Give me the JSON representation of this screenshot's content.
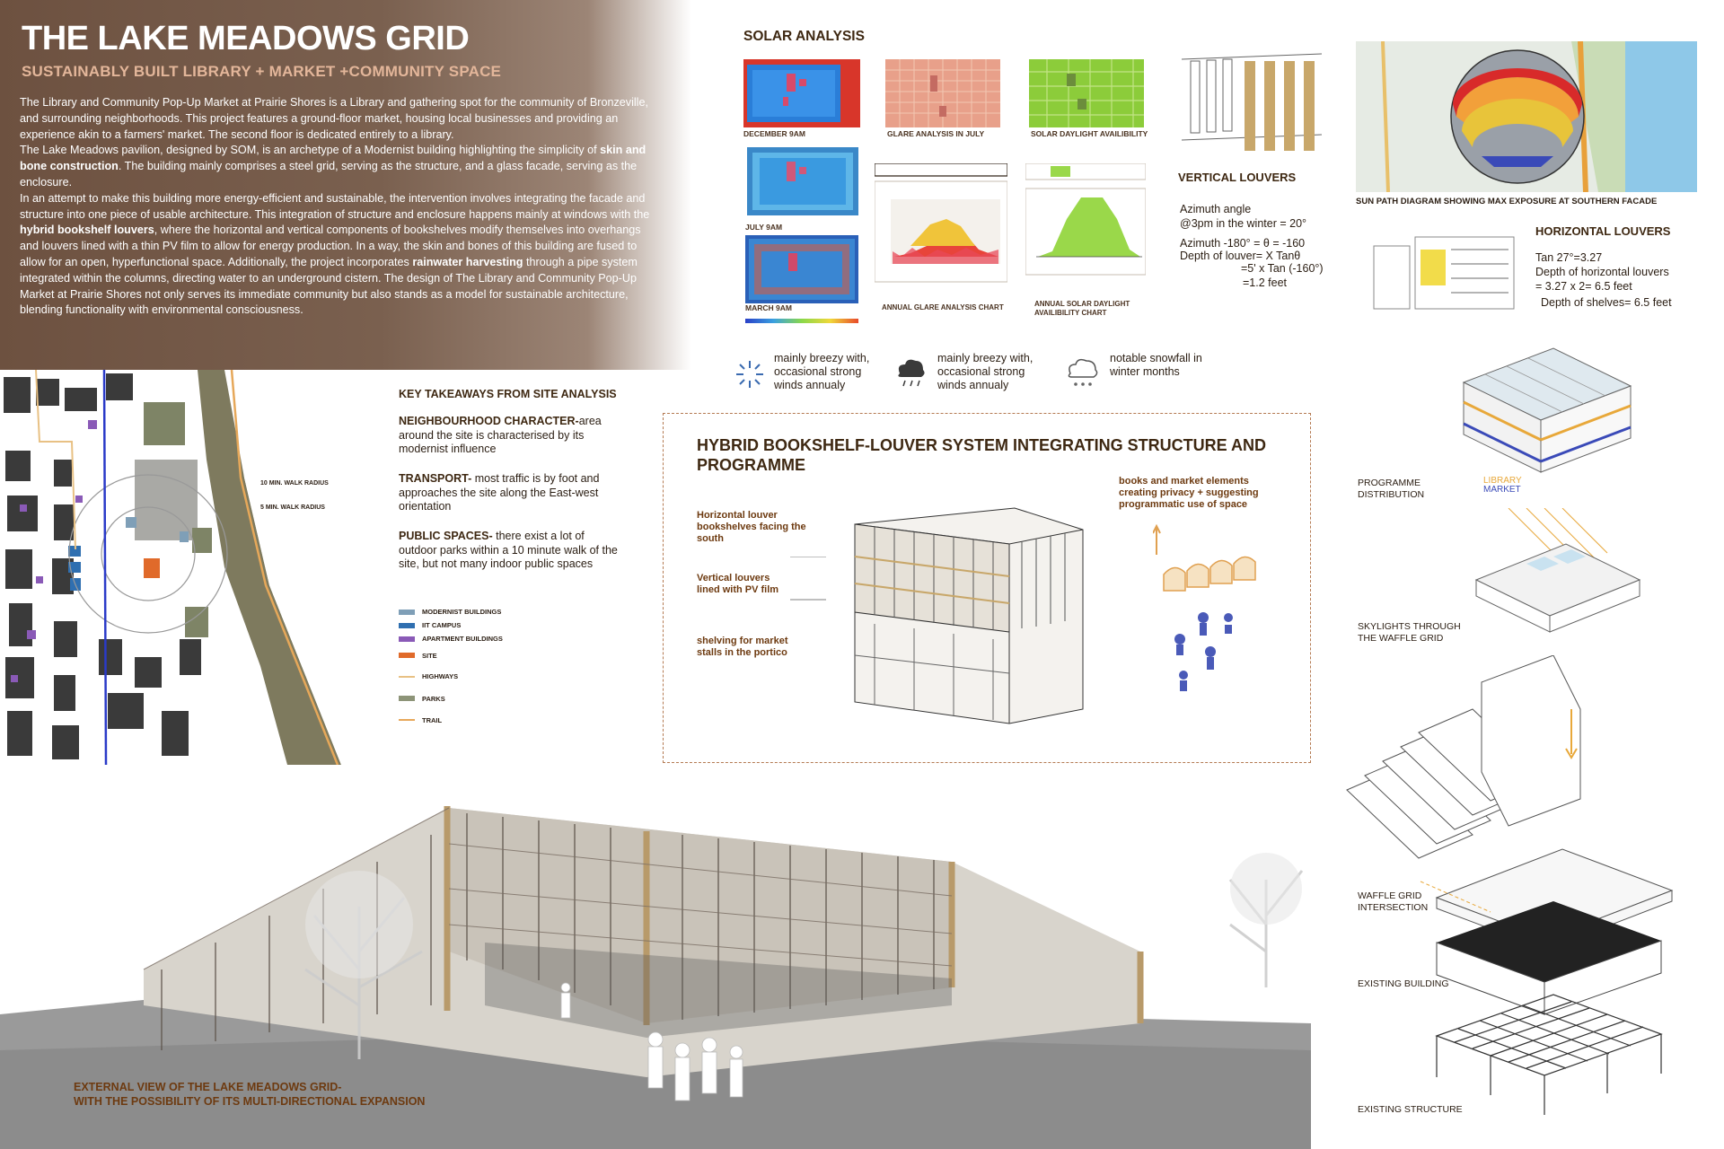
{
  "header": {
    "title": "THE LAKE MEADOWS GRID",
    "subtitle": "SUSTAINABLY BUILT LIBRARY + MARKET +COMMUNITY SPACE",
    "p1": "The Library and Community Pop-Up Market at Prairie Shores is a Library and gathering spot for the community of Bronzeville, and surrounding neighborhoods. This project features a ground-floor market, housing local businesses and providing an experience akin to a farmers' market. The second floor is dedicated entirely to a library.",
    "p2a": "The Lake Meadows pavilion, designed by SOM, is an archetype of a Modernist building highlighting the simplicity of ",
    "p2b": "skin and bone construction",
    "p2c": ". The building mainly comprises a steel grid, serving as the structure, and a glass facade, serving as the enclosure.",
    "p3a": "In an attempt to make this building more energy-efficient and sustainable, the intervention involves integrating the facade and structure into one piece of usable architecture. This integration of structure and enclosure happens mainly at windows with the ",
    "p3b": "hybrid bookshelf louvers",
    "p3c": ", where the horizontal and vertical components of bookshelves modify themselves into overhangs and louvers lined with a thin PV film to allow for energy production. In a way, the skin and bones of this building are fused to allow for an open, hyperfunctional space. Additionally, the project incorporates ",
    "p3d": "rainwater harvesting",
    "p3e": " through a pipe system integrated within the columns, directing water to an underground cistern. The design of The Library and Community Pop-Up Market at Prairie Shores not only serves its immediate community but also stands as a model for sustainable architecture, blending functionality with environmental consciousness."
  },
  "solar": {
    "title": "SOLAR ANALYSIS",
    "dec": "DECEMBER 9AM",
    "glare": "GLARE ANALYSIS IN JULY",
    "daylight": "SOLAR DAYLIGHT AVAILIBILITY",
    "july": "JULY 9AM",
    "march": "MARCH 9AM",
    "annual_glare": "ANNUAL GLARE ANALYSIS CHART",
    "annual_daylight_1": "ANNUAL SOLAR DAYLIGHT",
    "annual_daylight_2": "AVAILIBILITY CHART"
  },
  "weather": {
    "w1": "mainly breezy with, occasional strong winds annualy",
    "w2": "mainly breezy with, occasional strong winds annualy",
    "w3": "notable snowfall in winter months"
  },
  "vertical_louvers": {
    "title": "VERTICAL LOUVERS",
    "l1": "Azimuth angle",
    "l2": "@3pm in the winter = 20°",
    "l3": "Azimuth -180° = θ = -160",
    "l4": "Depth of louver= X Tanθ",
    "l5": "=5' x Tan (-160°)",
    "l6": "=1.2 feet"
  },
  "sun_path": {
    "caption": "SUN PATH DIAGRAM SHOWING MAX EXPOSURE AT SOUTHERN FACADE"
  },
  "horizontal_louvers": {
    "title": "HORIZONTAL LOUVERS",
    "l1": "Tan 27°=3.27",
    "l2": "Depth of horizontal louvers",
    "l3": "= 3.27 x 2= 6.5 feet",
    "l4": "Depth of shelves= 6.5 feet"
  },
  "site": {
    "walk10": "10 MIN. WALK RADIUS",
    "walk5": "5 MIN. WALK RADIUS",
    "key_title": "KEY TAKEAWAYS FROM SITE ANALYSIS",
    "k1h": "NEIGHBOURHOOD CHARACTER-",
    "k1b": "area around the site is characterised by its modernist influence",
    "k2h": "TRANSPORT-",
    "k2b": " most traffic is by foot and approaches the site along the East-west orientation",
    "k3h": "PUBLIC SPACES-",
    "k3b": " there exist a lot of outdoor parks within a 10 minute walk of the site, but not many indoor public spaces",
    "legend": [
      {
        "label": "MODERNIST BUILDINGS",
        "color": "#7f9fb7"
      },
      {
        "label": "IIT CAMPUS",
        "color": "#2f6fb0"
      },
      {
        "label": "APARTMENT BUILDINGS",
        "color": "#8a5ab7"
      },
      {
        "label": "SITE",
        "color": "#e06a2a"
      },
      {
        "label": "HIGHWAYS",
        "color": "#e8c184"
      },
      {
        "label": "PARKS",
        "color": "#8d9478"
      },
      {
        "label": "TRAIL",
        "color": "#e7a85a"
      }
    ]
  },
  "hybrid": {
    "title1": "HYBRID BOOKSHELF-LOUVER SYSTEM INTEGRATING STRUCTURE AND",
    "title2": "PROGRAMME",
    "a1": "Horizontal louver bookshelves facing the south",
    "a2": "Vertical louvers lined with PV film",
    "a3": "shelving for market stalls in the portico",
    "r1a": "books and market elements creating ",
    "r1b": "privacy",
    "r1c": " + suggesting programmatic use of space"
  },
  "axo": {
    "programme": "PROGRAMME DISTRIBUTION",
    "library": "LIBRARY",
    "market": "MARKET",
    "skylights": "SKYLIGHTS THROUGH THE WAFFLE GRID",
    "waffle": "WAFFLE GRID INTERSECTION",
    "existing_building": "EXISTING BUILDING",
    "existing_structure": "EXISTING STRUCTURE"
  },
  "render": {
    "caption1": "EXTERNAL VIEW OF THE LAKE MEADOWS GRID-",
    "caption2": "WITH THE POSSIBILITY OF ITS MULTI-DIRECTIONAL EXPANSION"
  }
}
